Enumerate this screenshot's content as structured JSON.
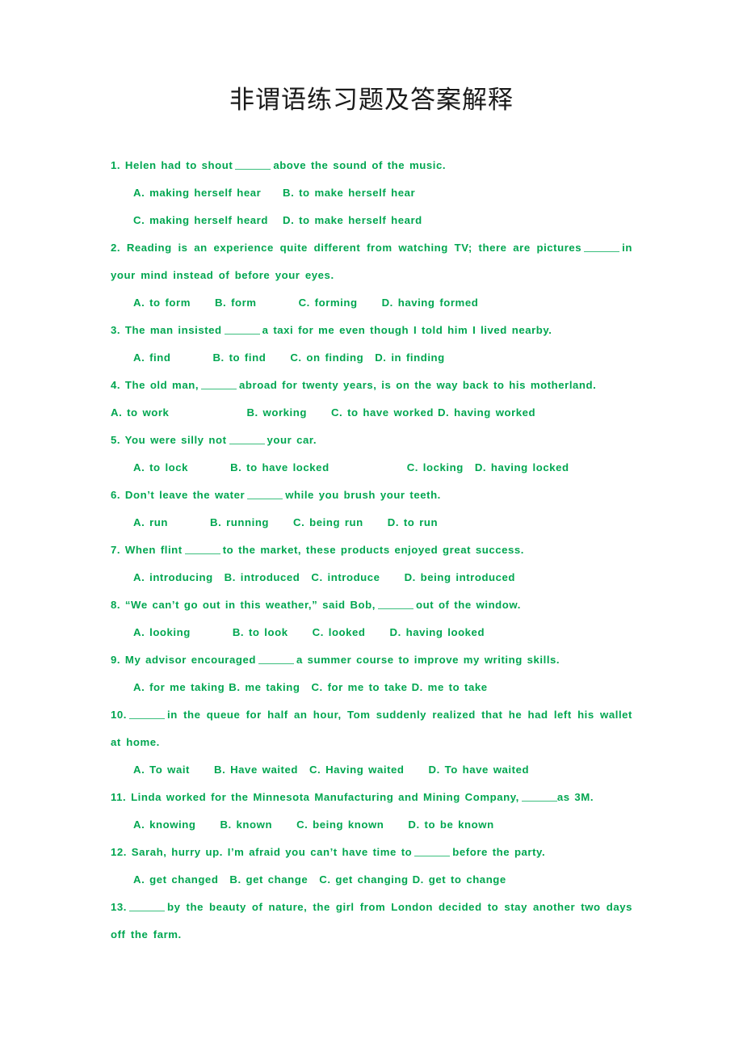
{
  "document": {
    "title": "非谓语练习题及答案解释",
    "text_color": "#00a650",
    "title_color": "#1a1a1a",
    "background": "#ffffff",
    "blank_marker": "______"
  },
  "questions": [
    {
      "number": "1.",
      "stem_before": "1. Helen had to shout",
      "stem_after": "above the sound of the music.",
      "layout": "grid-2x2",
      "options": [
        "A. making herself hear",
        "B. to make herself hear",
        "C. making herself heard",
        "D. to make herself heard"
      ]
    },
    {
      "number": "2.",
      "stem_before": "2. Reading is an experience quite different from watching TV; there are pictures",
      "stem_after": "in your mind instead of before your eyes.",
      "layout": "row",
      "options": [
        "A. to form",
        "B. form",
        "C. forming",
        "D. having formed"
      ]
    },
    {
      "number": "3.",
      "stem_before": "3. The man insisted",
      "stem_after": "a taxi for me even though I told him I lived nearby.",
      "layout": "row",
      "options": [
        "A. find",
        "B. to find",
        "C. on finding",
        "D. in finding"
      ]
    },
    {
      "number": "4.",
      "stem_before": "4. The old man,",
      "stem_after": "abroad for twenty years, is on the way back to his motherland.",
      "layout": "row-flush",
      "options": [
        "A. to work",
        "B. working",
        "C. to have worked",
        "D. having worked"
      ]
    },
    {
      "number": "5.",
      "stem_before": "5. You were silly not",
      "stem_after": "your car.",
      "layout": "row",
      "options": [
        "A. to lock",
        "B. to have locked",
        "C. locking",
        "D. having locked"
      ]
    },
    {
      "number": "6.",
      "stem_before": "6. Don’t leave the water",
      "stem_after": "while you brush your teeth.",
      "layout": "row",
      "options": [
        "A. run",
        "B. running",
        "C. being run",
        "D. to run"
      ]
    },
    {
      "number": "7.",
      "stem_before": "7. When flint",
      "stem_after": "to the market, these products enjoyed great success.",
      "layout": "row",
      "options": [
        "A. introducing",
        "B. introduced",
        "C. introduce",
        "D. being introduced"
      ]
    },
    {
      "number": "8.",
      "stem_before": "8. “We can’t go out in this weather,” said Bob,",
      "stem_after": "out of the window.",
      "layout": "row",
      "options": [
        "A. looking",
        "B. to look",
        "C. looked",
        "D. having looked"
      ]
    },
    {
      "number": "9.",
      "stem_before": "9. My advisor encouraged",
      "stem_after": "a summer course to improve my writing skills.",
      "layout": "row",
      "options": [
        "A. for me taking",
        "B. me taking",
        "C. for me to take",
        "D. me to take"
      ]
    },
    {
      "number": "10.",
      "stem_before": "10.",
      "stem_after": "in the queue for half an hour, Tom suddenly realized that he had left his wallet at home.",
      "layout": "row",
      "options": [
        "A. To wait",
        "B. Have waited",
        "C. Having waited",
        "D. To have waited"
      ]
    },
    {
      "number": "11.",
      "stem_before": "11. Linda worked for the Minnesota Manufacturing and Mining Company,",
      "stem_after": "as 3M.",
      "layout": "row",
      "options": [
        "A. knowing",
        "B. known",
        "C. being known",
        "D. to be known"
      ]
    },
    {
      "number": "12.",
      "stem_before": "12. Sarah, hurry up. I’m afraid you can’t have time to",
      "stem_after": "before the party.",
      "layout": "row",
      "options": [
        "A. get changed",
        "B. get change",
        "C. get changing",
        "D. get to change"
      ]
    },
    {
      "number": "13.",
      "stem_before": "13.",
      "stem_after": "by the beauty of nature, the girl from London decided to stay another two days off the farm.",
      "layout": "none",
      "options": []
    }
  ]
}
